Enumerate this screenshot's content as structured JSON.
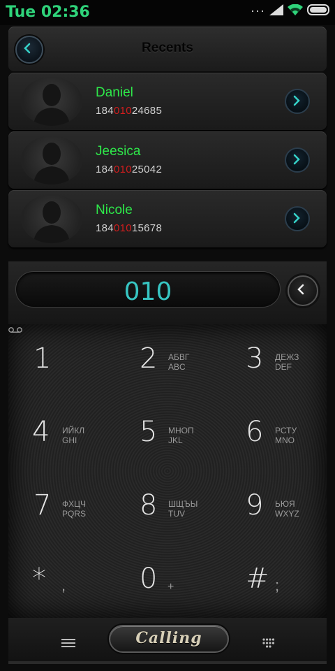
{
  "status": {
    "time": "Tue 02:36"
  },
  "header": {
    "title": "Recents"
  },
  "recents": [
    {
      "name": "Daniel",
      "num_pre": "184",
      "num_match": "010",
      "num_post": "24685"
    },
    {
      "name": "Jeesica",
      "num_pre": "184",
      "num_match": "010",
      "num_post": "25042"
    },
    {
      "name": "Nicole",
      "num_pre": "184",
      "num_match": "010",
      "num_post": "15678"
    }
  ],
  "dialer": {
    "input": "010"
  },
  "keys": {
    "k1": {
      "digit": "1"
    },
    "k2": {
      "digit": "2",
      "l1": "АБВГ",
      "l2": "ABC"
    },
    "k3": {
      "digit": "3",
      "l1": "ДЕЖЗ",
      "l2": "DEF"
    },
    "k4": {
      "digit": "4",
      "l1": "ИЙКЛ",
      "l2": "GHI"
    },
    "k5": {
      "digit": "5",
      "l1": "МНОП",
      "l2": "JKL"
    },
    "k6": {
      "digit": "6",
      "l1": "РСТУ",
      "l2": "MNO"
    },
    "k7": {
      "digit": "7",
      "l1": "ФХЦЧ",
      "l2": "PQRS"
    },
    "k8": {
      "digit": "8",
      "l1": "ШЩЪЫ",
      "l2": "TUV"
    },
    "k9": {
      "digit": "9",
      "l1": "ЬЮЯ",
      "l2": "WXYZ"
    },
    "kstar": {
      "digit": "*",
      "sym": ","
    },
    "k0": {
      "digit": "0",
      "sym": "+"
    },
    "khash": {
      "digit": "#",
      "sym": ";"
    }
  },
  "bottom": {
    "call_label": "Calling"
  },
  "icons": {
    "back": "chevron-left-icon",
    "row_action": "chevron-right-icon",
    "delete": "backspace-chevron-icon",
    "menu": "hamburger-menu-icon",
    "dialpad": "dialpad-icon"
  },
  "colors": {
    "accent": "#37c5c2",
    "name": "#2ee84a",
    "match": "#d21d1d",
    "status_time": "#2fd37a"
  }
}
